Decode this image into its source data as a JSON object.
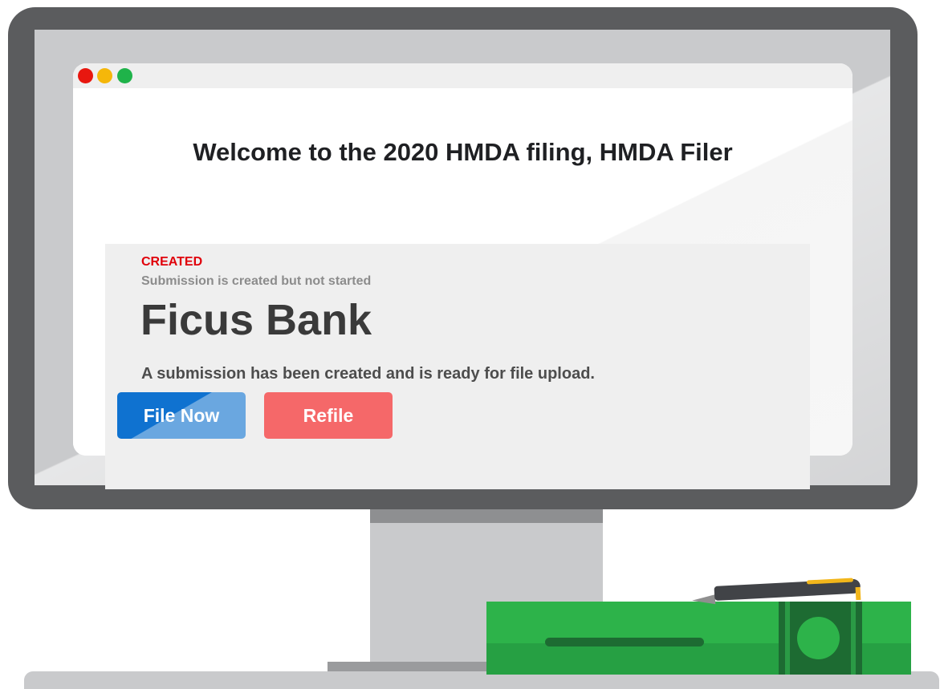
{
  "window": {
    "controls": [
      "close",
      "minimize",
      "maximize"
    ]
  },
  "welcome": {
    "title": "Welcome to the 2020 HMDA filing, HMDA Filer"
  },
  "submission": {
    "status": "CREATED",
    "status_description": "Submission is created but not started",
    "institution_name": "Ficus Bank",
    "message": "A submission has been created and is ready for file upload.",
    "file_now_label": "File Now",
    "refile_label": "Refile"
  },
  "colors": {
    "status_red": "#e0000a",
    "file_now_blue": "#0f72d0",
    "refile_red": "#f56869",
    "monitor_frame": "#5b5c5e",
    "cash_green": "#2db34a"
  },
  "icons": [
    "close-dot-icon",
    "minimize-dot-icon",
    "maximize-dot-icon",
    "pen-icon",
    "cash-bundle-icon"
  ]
}
